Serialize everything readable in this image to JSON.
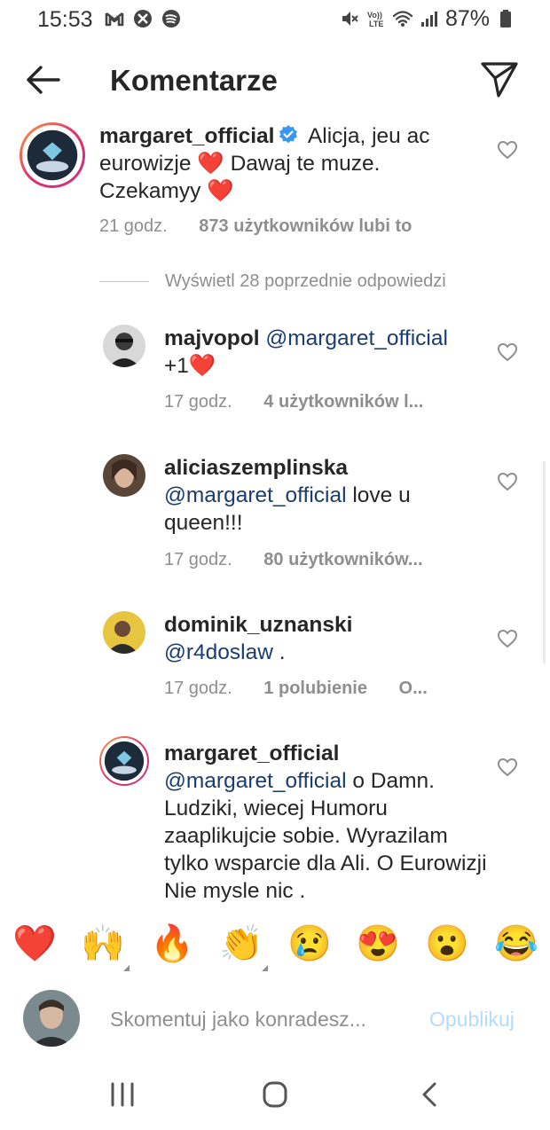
{
  "status_bar": {
    "time": "15:53",
    "battery": "87%",
    "left_icons": [
      "gmail-icon",
      "silent-app-icon",
      "spotify-icon"
    ],
    "right_icons": [
      "mute-icon",
      "volte-icon",
      "wifi-icon",
      "signal-icon",
      "battery-icon"
    ]
  },
  "header": {
    "title": "Komentarze",
    "back_icon": "arrow-left-icon",
    "share_icon": "paper-plane-icon"
  },
  "main_comment": {
    "username": "margaret_official",
    "verified": true,
    "text": "Alicja, jeu ac eurowizje ❤️ Dawaj te muze. Czekamyy ❤️",
    "time": "21 godz.",
    "likes": "873 użytkowników lubi to"
  },
  "view_replies": "Wyświetl 28 poprzednie odpowiedzi",
  "replies": [
    {
      "username": "majvopol",
      "mention": "@margaret_official",
      "text": "+1❤️",
      "time": "17 godz.",
      "likes": "4 użytkowników l..."
    },
    {
      "username": "aliciaszemplinska",
      "mention": "@margaret_official",
      "text": "love u queen!!!",
      "time": "17 godz.",
      "likes": "80 użytkowników..."
    },
    {
      "username": "dominik_uznanski",
      "mention": "@r4doslaw",
      "text": ".",
      "time": "17 godz.",
      "likes": "1 polubienie",
      "extra": "O..."
    },
    {
      "username": "margaret_official",
      "mention": "@margaret_official",
      "text": "o Damn. Ludziki, wiecej Humoru zaaplikujcie sobie. Wyrazilam tylko wsparcie dla Ali. O Eurowizji Nie mysle nic ."
    }
  ],
  "emoji_bar": [
    "❤️",
    "🙌",
    "🔥",
    "👏",
    "😢",
    "😍",
    "😮",
    "😂"
  ],
  "compose": {
    "placeholder": "Skomentuj jako konradesz...",
    "publish_label": "Opublikuj"
  },
  "colors": {
    "text": "#262626",
    "secondary": "#8e8e8e",
    "mention": "#1a3c6e",
    "verified": "#3897f0",
    "publish_disabled": "#b3dbff",
    "heart_emoji": "#ed1c24"
  }
}
